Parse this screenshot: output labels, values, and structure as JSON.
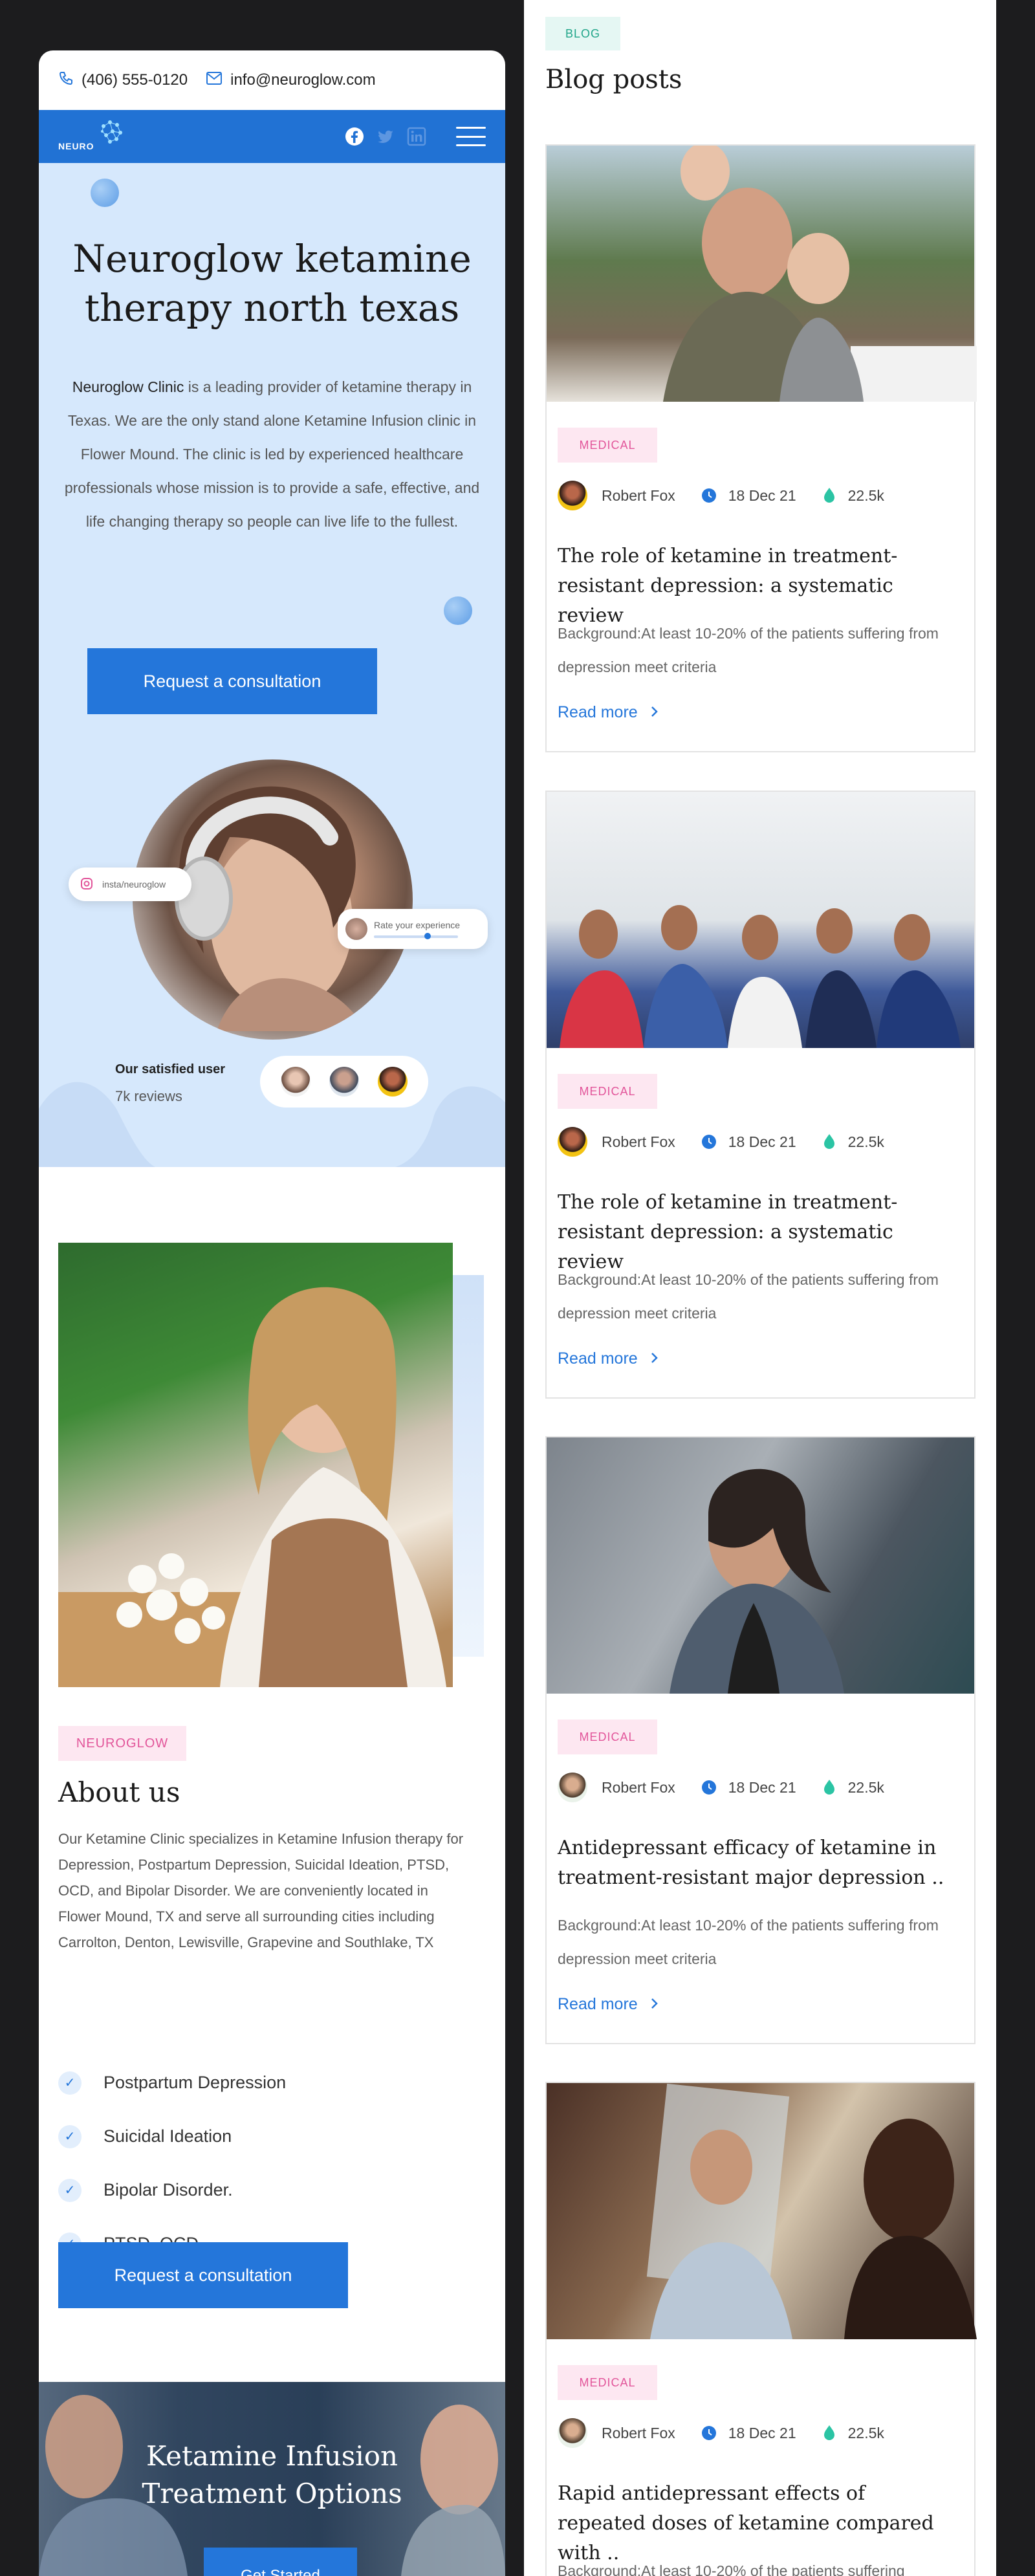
{
  "topbar": {
    "phone": "(406) 555-0120",
    "email": "info@neuroglow.com"
  },
  "navbar": {
    "logo_text": "NEURO"
  },
  "hero": {
    "title_line1": "Neuroglow ketamine",
    "title_line2": "therapy north texas",
    "intro_strong": "Neuroglow Clinic",
    "intro_text": " is a leading provider of ketamine therapy in Texas. We are the only stand alone Ketamine Infusion clinic in Flower Mound. The clinic is led by experienced healthcare professionals whose mission is to provide a safe, effective, and life changing therapy so people can live life to the fullest.",
    "cta": "Request a consultation",
    "instagram_handle": "insta/neuroglow",
    "rate_label": "Rate your experience",
    "satisfied_label": "Our satisfied user",
    "reviews_count": "7k reviews"
  },
  "about": {
    "tag": "NEUROGLOW",
    "title": "About us",
    "text": "Our Ketamine Clinic specializes in Ketamine Infusion therapy for Depression, Postpartum Depression, Suicidal Ideation, PTSD, OCD, and Bipolar Disorder. We are conveniently located in Flower Mound, TX and serve all surrounding cities including Carrolton, Denton, Lewisville, Grapevine and Southlake, TX",
    "conditions": [
      "Postpartum Depression",
      "Suicidal Ideation",
      "Bipolar Disorder.",
      "PTSD, OCD"
    ],
    "cta": "Request a consultation"
  },
  "banner": {
    "title_line1": "Ketamine Infusion",
    "title_line2": "Treatment Options",
    "cta": "Get Started"
  },
  "blog": {
    "tag": "BLOG",
    "title": "Blog posts",
    "read_more": "Read more",
    "posts": [
      {
        "category": "MEDICAL",
        "author": "Robert Fox",
        "date": "18 Dec 21",
        "views": "22.5k",
        "title": "The role of ketamine in treatment-resistant depression: a systematic review",
        "excerpt": "Background:At least 10-20% of the patients suffering from depression meet criteria"
      },
      {
        "category": "MEDICAL",
        "author": "Robert Fox",
        "date": "18 Dec 21",
        "views": "22.5k",
        "title": "The role of ketamine in treatment-resistant depression: a systematic review",
        "excerpt": "Background:At least 10-20% of the patients suffering from depression meet criteria"
      },
      {
        "category": "MEDICAL",
        "author": "Robert Fox",
        "date": "18 Dec 21",
        "views": "22.5k",
        "title": "Antidepressant efficacy of ketamine in treatment-resistant major depression ..",
        "excerpt": "Background:At least 10-20% of the patients suffering from depression meet criteria"
      },
      {
        "category": "MEDICAL",
        "author": "Robert Fox",
        "date": "18 Dec 21",
        "views": "22.5k",
        "title": "Rapid antidepressant effects of repeated doses of ketamine compared with ..",
        "excerpt": "Background:At least 10-20% of the patients suffering"
      }
    ]
  },
  "colors": {
    "primary": "#2476da",
    "navbar": "#2172d4",
    "hero_bg": "#d6e8fc",
    "pink": "#e2559a",
    "teal": "#20a589"
  },
  "icons": [
    "phone-icon",
    "mail-icon",
    "facebook-icon",
    "twitter-icon",
    "linkedin-icon",
    "menu-icon",
    "instagram-icon",
    "check-icon",
    "clock-icon",
    "drop-icon",
    "chevron-right-icon"
  ]
}
